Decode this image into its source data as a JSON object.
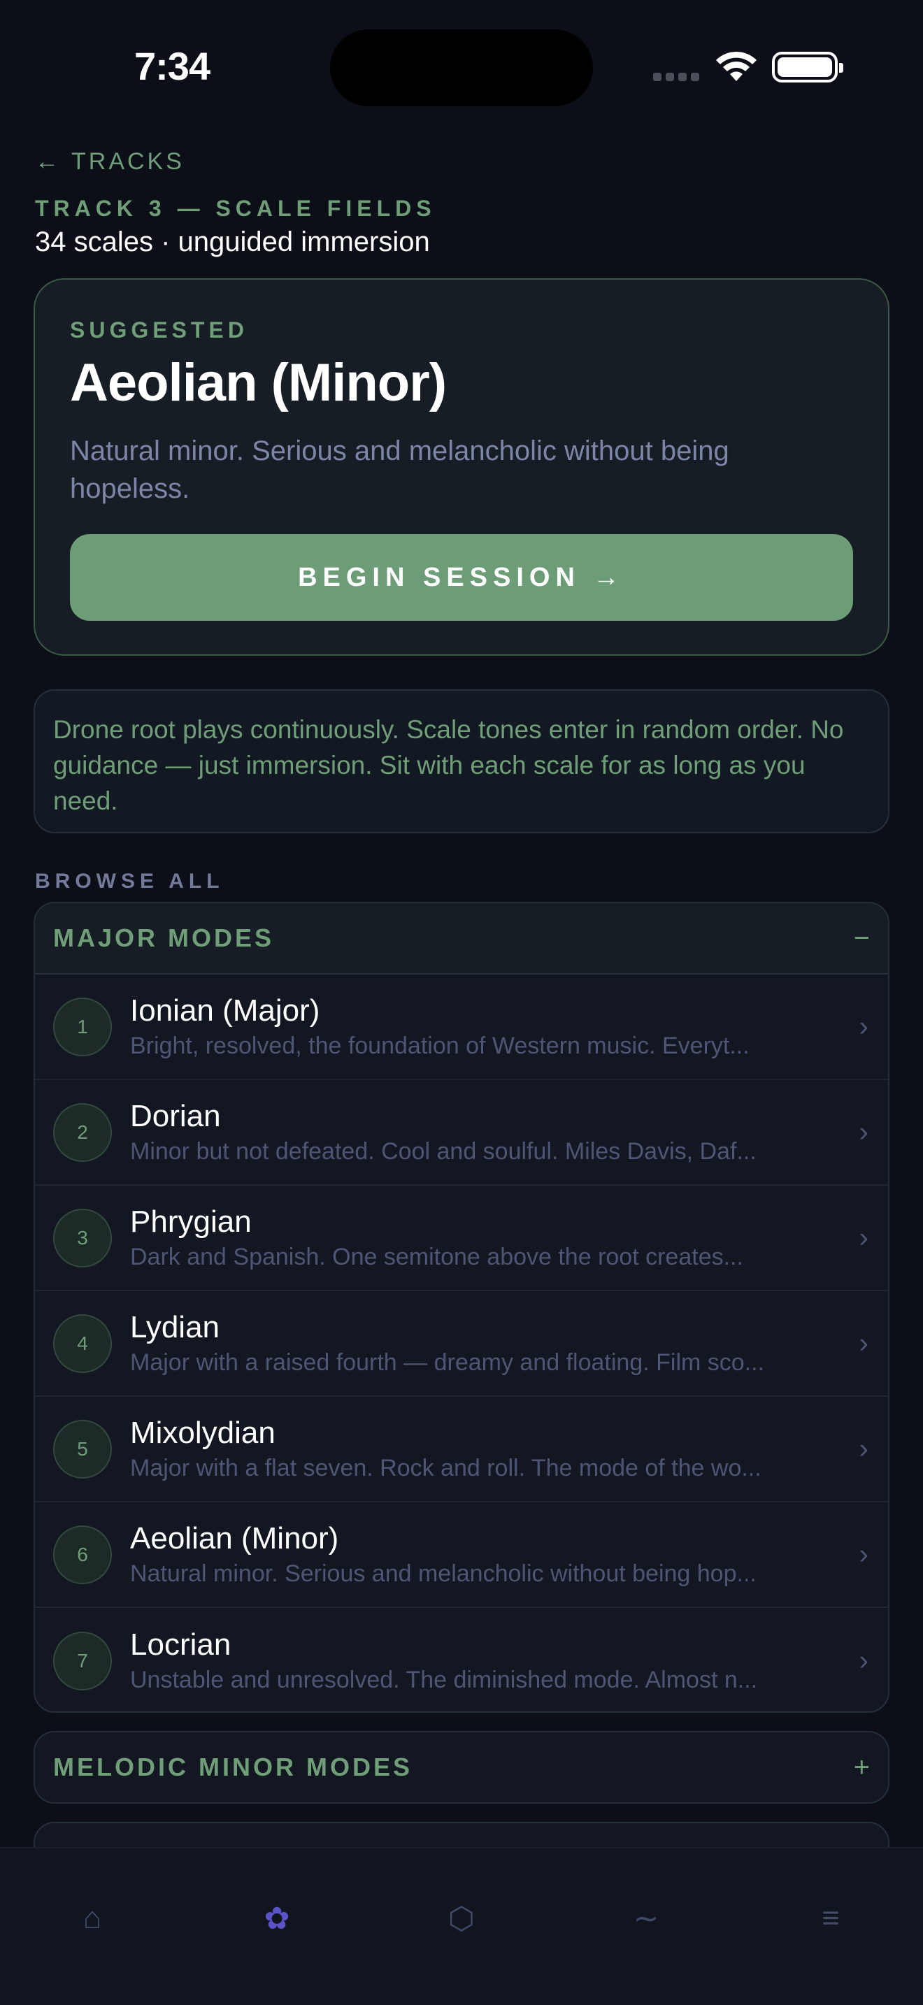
{
  "status_bar": {
    "time": "7:34"
  },
  "nav": {
    "back_label": "TRACKS",
    "back_icon": "←"
  },
  "track": {
    "title": "TRACK 3 — SCALE FIELDS",
    "subtitle": "34 scales · unguided immersion"
  },
  "suggested": {
    "label": "SUGGESTED",
    "name": "Aeolian (Minor)",
    "description": "Natural minor. Serious and melancholic without being hopeless.",
    "button_label": "BEGIN SESSION",
    "button_icon": "→"
  },
  "info": {
    "text": "Drone root plays continuously. Scale tones enter in random order. No guidance — just immersion. Sit with each scale for as long as you need."
  },
  "browse": {
    "label": "BROWSE ALL",
    "groups": [
      {
        "title": "MAJOR MODES",
        "toggle": "−",
        "scales": [
          {
            "num": "1",
            "name": "Ionian (Major)",
            "desc": "Bright, resolved, the foundation of Western music. Everyt..."
          },
          {
            "num": "2",
            "name": "Dorian",
            "desc": "Minor but not defeated. Cool and soulful. Miles Davis, Daf..."
          },
          {
            "num": "3",
            "name": "Phrygian",
            "desc": "Dark and Spanish. One semitone above the root creates..."
          },
          {
            "num": "4",
            "name": "Lydian",
            "desc": "Major with a raised fourth — dreamy and floating. Film sco..."
          },
          {
            "num": "5",
            "name": "Mixolydian",
            "desc": "Major with a flat seven. Rock and roll. The mode of the wo..."
          },
          {
            "num": "6",
            "name": "Aeolian (Minor)",
            "desc": "Natural minor. Serious and melancholic without being hop..."
          },
          {
            "num": "7",
            "name": "Locrian",
            "desc": "Unstable and unresolved. The diminished mode. Almost n..."
          }
        ]
      },
      {
        "title": "MELODIC MINOR MODES",
        "toggle": "+"
      }
    ]
  },
  "tabs": [
    {
      "name": "home",
      "glyph": "⌂"
    },
    {
      "name": "flower",
      "glyph": "✿"
    },
    {
      "name": "hexagon",
      "glyph": "⬡"
    },
    {
      "name": "wave",
      "glyph": "∼"
    },
    {
      "name": "menu",
      "glyph": "≡"
    }
  ],
  "colors": {
    "background": "#0c0f17",
    "accent_green": "#6c9d76",
    "accent_purple": "#5b53c8",
    "muted_text": "#7d86a8"
  }
}
